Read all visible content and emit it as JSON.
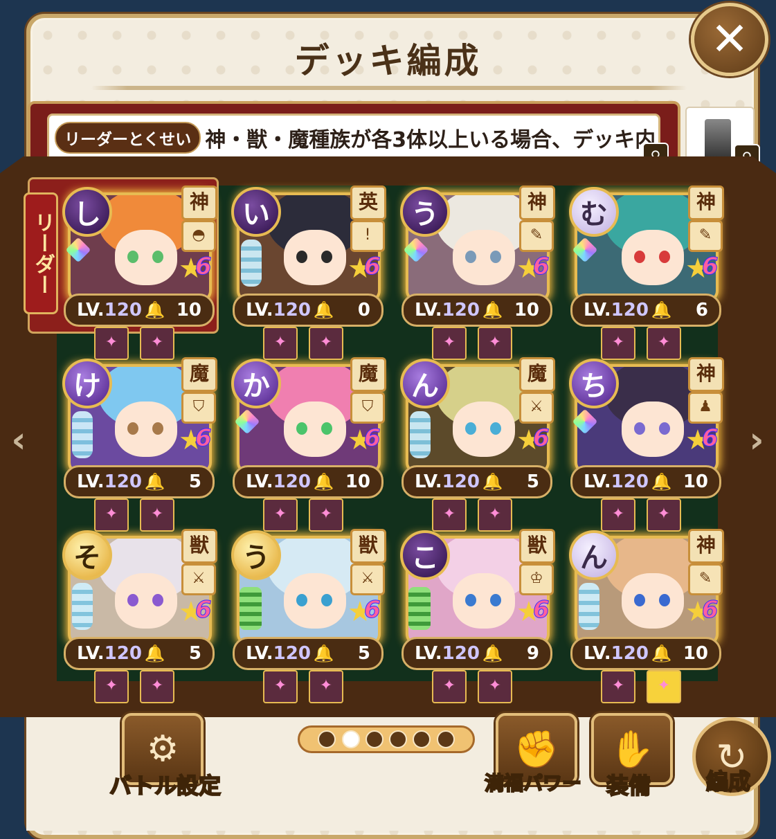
{
  "header": {
    "title": "デッキ編成",
    "close_label": "✕"
  },
  "leader_skill": {
    "tag": "リーダーとくせい",
    "text": "神・獣・魔種族が各3体以上いる場合、デッキ内"
  },
  "leader_banner": "リーダー",
  "cards": [
    {
      "initial": "し",
      "race": "神",
      "skill": "◓",
      "level": "120",
      "count": "10",
      "badge": "purple",
      "hair": "#f08a3a",
      "eye": "#5bbd6b",
      "bg": "#6f3d4d",
      "deco": "gem"
    },
    {
      "initial": "い",
      "race": "英",
      "skill": "!",
      "level": "120",
      "count": "0",
      "badge": "purple",
      "hair": "#2c2c3a",
      "eye": "#2a2a2a",
      "bg": "#6a4630",
      "deco": "buff"
    },
    {
      "initial": "う",
      "race": "神",
      "skill": "✎",
      "level": "120",
      "count": "10",
      "badge": "purple",
      "hair": "#ece8e0",
      "eye": "#7a9ab8",
      "bg": "#8a6c7a",
      "deco": "gem"
    },
    {
      "initial": "む",
      "race": "神",
      "skill": "✎",
      "level": "120",
      "count": "6",
      "badge": "light",
      "hair": "#3aa7a0",
      "eye": "#d83b3b",
      "bg": "#3c6a75",
      "deco": "gem"
    },
    {
      "initial": "け",
      "race": "魔",
      "skill": "⛉",
      "level": "120",
      "count": "5",
      "badge": "violet",
      "hair": "#7fc8f0",
      "eye": "#a7794a",
      "bg": "#6b4aa0",
      "deco": "buff"
    },
    {
      "initial": "か",
      "race": "魔",
      "skill": "⛉",
      "level": "120",
      "count": "10",
      "badge": "violet",
      "hair": "#f07fb0",
      "eye": "#4bc46b",
      "bg": "#6f3a78",
      "deco": "gem"
    },
    {
      "initial": "ん",
      "race": "魔",
      "skill": "⚔",
      "level": "120",
      "count": "5",
      "badge": "violet",
      "hair": "#d6d08a",
      "eye": "#4aaed6",
      "bg": "#5c4a2a",
      "deco": "buff"
    },
    {
      "initial": "ち",
      "race": "神",
      "skill": "♟",
      "level": "120",
      "count": "10",
      "badge": "violet",
      "hair": "#3a2e4a",
      "eye": "#7a6ad0",
      "bg": "#4a3a7a",
      "deco": "gem"
    },
    {
      "initial": "そ",
      "race": "獣",
      "skill": "⚔",
      "level": "120",
      "count": "5",
      "badge": "gold",
      "hair": "#e8e2ea",
      "eye": "#8a5ad0",
      "bg": "#c9b9a6",
      "deco": "buff"
    },
    {
      "initial": "う",
      "race": "獣",
      "skill": "⚔",
      "level": "120",
      "count": "5",
      "badge": "gold",
      "hair": "#d6eaf4",
      "eye": "#3aa0d0",
      "bg": "#a7c7e0",
      "deco": "leaf"
    },
    {
      "initial": "こ",
      "race": "獣",
      "skill": "♔",
      "level": "120",
      "count": "9",
      "badge": "purple",
      "hair": "#f3d0e6",
      "eye": "#3a7ad0",
      "bg": "#e0a6c8",
      "deco": "leaf"
    },
    {
      "initial": "ん",
      "race": "神",
      "skill": "✎",
      "level": "120",
      "count": "10",
      "badge": "light",
      "hair": "#e7b78a",
      "eye": "#3a6ad0",
      "bg": "#b89a7a",
      "deco": "buff"
    }
  ],
  "lv_prefix": "LV.",
  "pager": {
    "pages": 6,
    "active": 1
  },
  "buttons": {
    "battle_settings": "バトル設定",
    "fullness_power": "満福パワー",
    "equipment": "装備",
    "formation": "編成"
  }
}
